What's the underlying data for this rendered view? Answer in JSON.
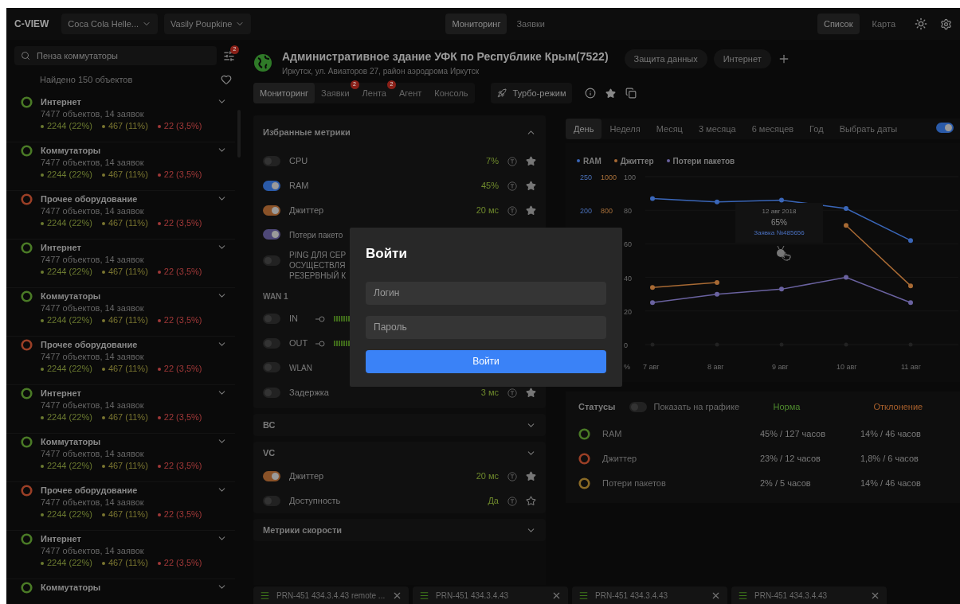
{
  "topbar": {
    "logo": "C-VIEW",
    "dropdowns": [
      "Coca Cola Helle...",
      "Vasily Poupkine"
    ],
    "tabs": [
      {
        "label": "Мониторинг",
        "selected": true
      },
      {
        "label": "Заявки",
        "selected": false
      }
    ],
    "views": [
      {
        "label": "Список",
        "selected": true
      },
      {
        "label": "Карта",
        "selected": false
      }
    ]
  },
  "sidebar": {
    "search": {
      "value": "Пенза коммутаторы"
    },
    "filter_badge": "2",
    "found": "Найдено 150 объектов",
    "items": [
      {
        "title": "Интернет",
        "subtitle": "7477 объектов, 14 заявок",
        "color": "#4a7a26",
        "stats": [
          {
            "text": "2244 (22%)",
            "color": "#6b7a30"
          },
          {
            "text": "467 (11%)",
            "color": "#7a7530"
          },
          {
            "text": "22 (3,5%)",
            "color": "#a03838"
          }
        ]
      },
      {
        "title": "Коммутаторы",
        "subtitle": "7477 объектов, 14 заявок",
        "color": "#4a7a26",
        "stats": [
          {
            "text": "2244 (22%)",
            "color": "#6b7a30"
          },
          {
            "text": "467 (11%)",
            "color": "#7a7530"
          },
          {
            "text": "22 (3,5%)",
            "color": "#a03838"
          }
        ]
      },
      {
        "title": "Прочее оборудование",
        "subtitle": "7477 объектов, 14 заявок",
        "color": "#9a3f26",
        "stats": [
          {
            "text": "2244 (22%)",
            "color": "#6b7a30"
          },
          {
            "text": "467 (11%)",
            "color": "#7a7530"
          },
          {
            "text": "22 (3,5%)",
            "color": "#a03838"
          }
        ]
      },
      {
        "title": "Интернет",
        "subtitle": "7477 объектов, 14 заявок",
        "color": "#4a7a26",
        "stats": [
          {
            "text": "2244 (22%)",
            "color": "#6b7a30"
          },
          {
            "text": "467 (11%)",
            "color": "#7a7530"
          },
          {
            "text": "22 (3,5%)",
            "color": "#a03838"
          }
        ]
      },
      {
        "title": "Коммутаторы",
        "subtitle": "7477 объектов, 14 заявок",
        "color": "#4a7a26",
        "stats": [
          {
            "text": "2244 (22%)",
            "color": "#6b7a30"
          },
          {
            "text": "467 (11%)",
            "color": "#7a7530"
          },
          {
            "text": "22 (3,5%)",
            "color": "#a03838"
          }
        ]
      },
      {
        "title": "Прочее оборудование",
        "subtitle": "7477 объектов, 14 заявок",
        "color": "#9a3f26",
        "stats": [
          {
            "text": "2244 (22%)",
            "color": "#6b7a30"
          },
          {
            "text": "467 (11%)",
            "color": "#7a7530"
          },
          {
            "text": "22 (3,5%)",
            "color": "#a03838"
          }
        ]
      },
      {
        "title": "Интернет",
        "subtitle": "7477 объектов, 14 заявок",
        "color": "#4a7a26",
        "stats": [
          {
            "text": "2244 (22%)",
            "color": "#6b7a30"
          },
          {
            "text": "467 (11%)",
            "color": "#7a7530"
          },
          {
            "text": "22 (3,5%)",
            "color": "#a03838"
          }
        ]
      },
      {
        "title": "Коммутаторы",
        "subtitle": "7477 объектов, 14 заявок",
        "color": "#4a7a26",
        "stats": [
          {
            "text": "2244 (22%)",
            "color": "#6b7a30"
          },
          {
            "text": "467 (11%)",
            "color": "#7a7530"
          },
          {
            "text": "22 (3,5%)",
            "color": "#a03838"
          }
        ]
      },
      {
        "title": "Прочее оборудование",
        "subtitle": "7477 объектов, 14 заявок",
        "color": "#9a3f26",
        "stats": [
          {
            "text": "2244 (22%)",
            "color": "#6b7a30"
          },
          {
            "text": "467 (11%)",
            "color": "#7a7530"
          },
          {
            "text": "22 (3,5%)",
            "color": "#a03838"
          }
        ]
      },
      {
        "title": "Интернет",
        "subtitle": "7477 объектов, 14 заявок",
        "color": "#4a7a26",
        "stats": [
          {
            "text": "2244 (22%)",
            "color": "#6b7a30"
          },
          {
            "text": "467 (11%)",
            "color": "#7a7530"
          },
          {
            "text": "22 (3,5%)",
            "color": "#a03838"
          }
        ]
      },
      {
        "title": "Коммутаторы",
        "color": "#4a7a26"
      }
    ]
  },
  "object": {
    "title": "Административное здание УФК по Республике Крым(7522)",
    "address": "Иркутск, ул. Авиаторов 27, район аэродрома Иркутск",
    "chips": [
      "Защита данных",
      "Интернет"
    ],
    "tabs": [
      {
        "label": "Мониторинг",
        "selected": true
      },
      {
        "label": "Заявки",
        "selected": false,
        "badge": "2"
      },
      {
        "label": "Лента",
        "selected": false,
        "badge": "2"
      },
      {
        "label": "Агент",
        "selected": false
      },
      {
        "label": "Консоль",
        "selected": false
      }
    ],
    "turbo": "Турбо-режим"
  },
  "metrics": {
    "title": "Избранные метрики",
    "rows": [
      {
        "kind": "metric",
        "name": "CPU",
        "on": false,
        "color": "#262626",
        "value": "7%",
        "starred": true
      },
      {
        "kind": "metric",
        "name": "RAM",
        "on": true,
        "color": "#2a5aa8",
        "value": "45%",
        "starred": true
      },
      {
        "kind": "metric",
        "name": "Джиттер",
        "on": true,
        "color": "#8a5228",
        "value": "20 мс",
        "starred": true
      },
      {
        "kind": "covered",
        "name": "Потери пакето",
        "on": true,
        "color": "#4e4878"
      },
      {
        "kind": "covered",
        "lines": [
          "PING ДЛЯ СЕР",
          "ОСУЩЕСТВЛЯ",
          "РЕЗЕРВНЫЙ К"
        ],
        "on": false,
        "color": "#262626"
      },
      {
        "kind": "section",
        "name": "WAN 1"
      },
      {
        "kind": "traffic",
        "name": "IN",
        "on": false,
        "color": "#262626"
      },
      {
        "kind": "traffic",
        "name": "OUT",
        "on": false,
        "color": "#262626"
      },
      {
        "kind": "covered",
        "name": "WLAN",
        "on": false,
        "color": "#262626"
      },
      {
        "kind": "metric",
        "name": "Задержка",
        "on": false,
        "color": "#262626",
        "value": "3 мс",
        "starred": true
      }
    ]
  },
  "groups": [
    {
      "title": "ВС"
    },
    {
      "title": "VC",
      "rows": [
        {
          "name": "Джиттер",
          "on": true,
          "color": "#8a5228",
          "value": "20 мс",
          "starred": true
        },
        {
          "name": "Доступность",
          "on": false,
          "color": "#262626",
          "value": "Да",
          "starred": false
        }
      ]
    },
    {
      "title": "Метрики скорости"
    }
  ],
  "periods": [
    {
      "label": "День",
      "selected": true
    },
    {
      "label": "Неделя",
      "selected": false
    },
    {
      "label": "Месяц",
      "selected": false
    },
    {
      "label": "3 месяца",
      "selected": false
    },
    {
      "label": "6 месяцев",
      "selected": false
    },
    {
      "label": "Год",
      "selected": false
    },
    {
      "label": "Выбрать даты",
      "selected": false
    }
  ],
  "period_switch": {
    "on": true
  },
  "chart": {
    "secondary_axes": [
      [
        "250",
        "200"
      ],
      [
        "1000",
        "800"
      ]
    ],
    "tooltip": {
      "date": "12 авг 2018",
      "value": "65%",
      "link": "Заявка №485656"
    },
    "chart_data": {
      "type": "line",
      "categories": [
        "7 авг",
        "8 авг",
        "9 авг",
        "10 авг",
        "11 авг"
      ],
      "ylabel": "%",
      "ylim": [
        0,
        100
      ],
      "grid": true,
      "yticks": [
        0,
        20,
        40,
        60,
        80,
        100
      ],
      "series": [
        {
          "name": "RAM",
          "color": "#3a66b8",
          "marker": "circle",
          "values": [
            87,
            85,
            86,
            81,
            62
          ]
        },
        {
          "name": "Джиттер",
          "color": "#a86a34",
          "marker": "circle",
          "values": [
            34,
            37,
            null,
            71,
            35
          ]
        },
        {
          "name": "Потери пакетов",
          "color": "#6a62a0",
          "marker": "circle",
          "values": [
            25,
            30,
            33,
            40,
            25
          ]
        }
      ]
    }
  },
  "statuses": {
    "title": "Статусы",
    "show_label": "Показать на графике",
    "show_on": false,
    "columns": [
      "Норма",
      "Отклонение"
    ],
    "rows": [
      {
        "name": "RAM",
        "color": "#4a7a26",
        "norm": "45% / 127 часов",
        "deviation": "14% / 46 часов"
      },
      {
        "name": "Джиттер",
        "color": "#9a3f26",
        "norm": "23% / 12 часов",
        "deviation": "1,8% / 6 часов"
      },
      {
        "name": "Потери пакетов",
        "color": "#8a6a26",
        "norm": "2% / 5 часов",
        "deviation": "14% / 46 часов"
      }
    ]
  },
  "bottom_tabs": [
    "PRN-451 434.3.4.43 remote ...",
    "PRN-451 434.3.4.43",
    "PRN-451 434.3.4.43",
    "PRN-451 434.3.4.43"
  ],
  "login": {
    "title": "Войти",
    "fields": [
      {
        "placeholder": "Логин"
      },
      {
        "placeholder": "Пароль"
      }
    ],
    "button": "Войти"
  }
}
